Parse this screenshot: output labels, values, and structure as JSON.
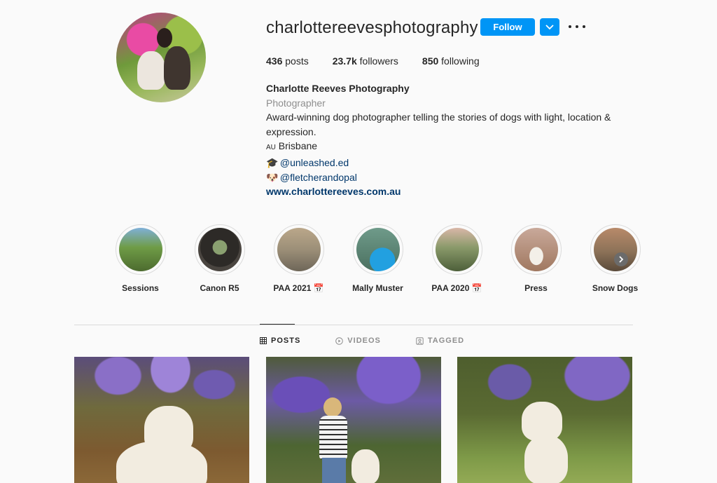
{
  "profile": {
    "username": "charlottereevesphotography",
    "follow_label": "Follow"
  },
  "stats": {
    "posts_count": "436",
    "posts_label": "posts",
    "followers_count": "23.7k",
    "followers_label": "followers",
    "following_count": "850",
    "following_label": "following"
  },
  "bio": {
    "name": "Charlotte Reeves Photography",
    "category": "Photographer",
    "description": "Award-winning dog photographer telling the stories of dogs with light, location & expression.",
    "location_flag": "AU",
    "location": "Brisbane",
    "mention1_emoji": "graduation-cap-icon",
    "mention1": "@unleashed.ed",
    "mention2_emoji": "dog-face-icon",
    "mention2": "@fletcherandopal",
    "website": "www.charlottereeves.com.au"
  },
  "highlights": [
    {
      "label": "Sessions",
      "color": "#6f9c46"
    },
    {
      "label": "Canon R5",
      "color": "#4a4540"
    },
    {
      "label": "PAA 2021 📅",
      "color": "#9c8f78"
    },
    {
      "label": "Mally Muster",
      "color": "#3c8fc9"
    },
    {
      "label": "PAA 2020 📅",
      "color": "#7e8a5a"
    },
    {
      "label": "Press",
      "color": "#c9a99a"
    },
    {
      "label": "Snow Dogs",
      "color": "#8c7258"
    }
  ],
  "tabs": [
    {
      "label": "POSTS",
      "icon": "grid-icon",
      "active": true
    },
    {
      "label": "VIDEOS",
      "icon": "play-icon",
      "active": false
    },
    {
      "label": "TAGGED",
      "icon": "tag-icon",
      "active": false
    }
  ],
  "colors": {
    "accent": "#0095f6",
    "link": "#00376b",
    "muted": "#8e8e8e"
  }
}
